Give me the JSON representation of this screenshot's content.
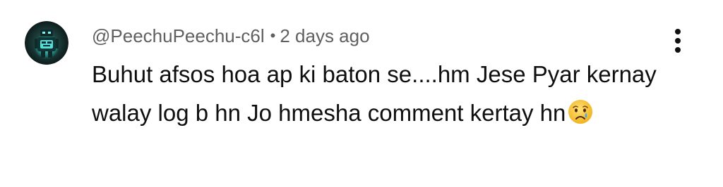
{
  "comment": {
    "author": "@PeechuPeechu-c6l",
    "separator": "•",
    "timestamp": "2 days ago",
    "text": "Buhut afsos hoa ap ki baton se....hm Jese Pyar kernay walay log b hn Jo hmesha comment kertay hn",
    "emoji_icon": "crying-face-icon",
    "avatar_icon": "robot-avatar-icon"
  },
  "menu": {
    "icon": "more-vert-icon"
  },
  "colors": {
    "meta_text": "#606060",
    "body_text": "#0f0f0f",
    "avatar_bg": "#1b2b2a",
    "avatar_glow": "#3fd6d6"
  }
}
